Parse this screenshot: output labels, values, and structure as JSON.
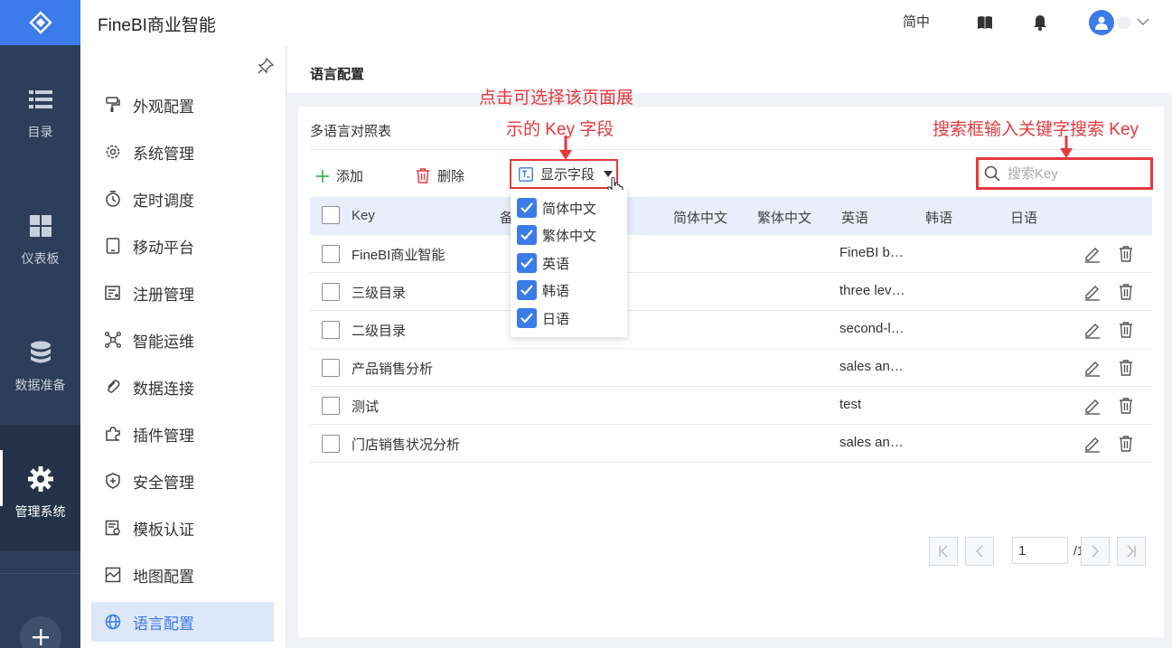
{
  "app": {
    "title": "FineBI商业智能"
  },
  "header": {
    "lang_switch": "简中"
  },
  "rail": {
    "items": [
      {
        "label": "目录",
        "icon": "list-icon"
      },
      {
        "label": "仪表板",
        "icon": "dashboard-icon"
      },
      {
        "label": "数据准备",
        "icon": "database-icon"
      },
      {
        "label": "管理系统",
        "icon": "gear-icon"
      }
    ]
  },
  "sidebar": {
    "items": [
      {
        "label": "外观配置",
        "icon": "paint-roller-icon"
      },
      {
        "label": "系统管理",
        "icon": "gear-icon"
      },
      {
        "label": "定时调度",
        "icon": "timer-icon"
      },
      {
        "label": "移动平台",
        "icon": "tablet-icon"
      },
      {
        "label": "注册管理",
        "icon": "register-icon"
      },
      {
        "label": "智能运维",
        "icon": "network-icon"
      },
      {
        "label": "数据连接",
        "icon": "link-icon"
      },
      {
        "label": "插件管理",
        "icon": "puzzle-icon"
      },
      {
        "label": "安全管理",
        "icon": "shield-icon"
      },
      {
        "label": "模板认证",
        "icon": "certificate-icon"
      },
      {
        "label": "地图配置",
        "icon": "map-icon"
      },
      {
        "label": "语言配置",
        "icon": "globe-icon"
      }
    ]
  },
  "page": {
    "title": "语言配置",
    "panel_title": "多语言对照表"
  },
  "toolbar": {
    "add_label": "添加",
    "delete_label": "删除",
    "fields_label": "显示字段",
    "search_placeholder": "搜索Key"
  },
  "table": {
    "headers": {
      "key": "Key",
      "remark": "备",
      "zh_cn": "简体中文",
      "zh_tw": "繁体中文",
      "en": "英语",
      "ko": "韩语",
      "ja": "日语"
    },
    "rows": [
      {
        "key": "FineBI商业智能",
        "en": "FineBI b…"
      },
      {
        "key": "三级目录",
        "en": "three lev…"
      },
      {
        "key": "二级目录",
        "en": "second-l…"
      },
      {
        "key": "产品销售分析",
        "en": "sales an…"
      },
      {
        "key": "测试",
        "en": "test"
      },
      {
        "key": "门店销售状况分析",
        "en": "sales an…"
      }
    ]
  },
  "dropdown": {
    "options": [
      {
        "label": "简体中文",
        "checked": true
      },
      {
        "label": "繁体中文",
        "checked": true
      },
      {
        "label": "英语",
        "checked": true
      },
      {
        "label": "韩语",
        "checked": true
      },
      {
        "label": "日语",
        "checked": true
      }
    ]
  },
  "pagination": {
    "current": "1",
    "total": "/1"
  },
  "annotations": {
    "fields_line1": "点击可选择该页面展",
    "fields_line2": "示的 Key 字段",
    "search": "搜索框输入关键字搜索 Key"
  },
  "colors": {
    "brand": "#3b7bea",
    "rail": "#2c3e5a",
    "annotation": "#e8383d",
    "danger": "#e8383d",
    "add": "#2bb24c"
  }
}
